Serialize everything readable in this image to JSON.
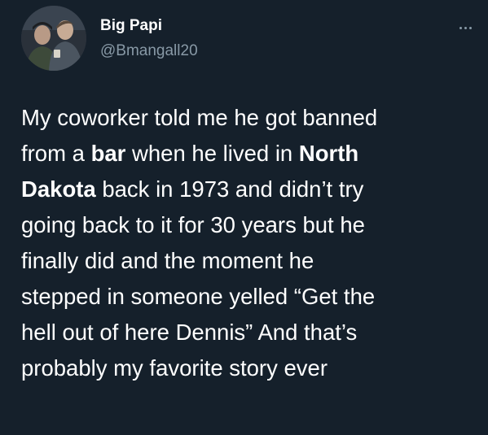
{
  "author": {
    "display_name": "Big Papi",
    "handle": "@Bmangall20",
    "avatar_icon": "profile-photo-two-men"
  },
  "menu": {
    "icon": "more-options-icon"
  },
  "tweet": {
    "lines": [
      [
        {
          "text": "My coworker told me he got banned",
          "bold": false
        }
      ],
      [
        {
          "text": "from a ",
          "bold": false
        },
        {
          "text": "bar",
          "bold": true
        },
        {
          "text": " when he lived in ",
          "bold": false
        },
        {
          "text": "North",
          "bold": true
        }
      ],
      [
        {
          "text": "Dakota",
          "bold": true
        },
        {
          "text": " back in 1973 and didn’t try",
          "bold": false
        }
      ],
      [
        {
          "text": "going back to it for 30 years but he",
          "bold": false
        }
      ],
      [
        {
          "text": "finally did and the moment he",
          "bold": false
        }
      ],
      [
        {
          "text": "stepped in someone yelled “Get the",
          "bold": false
        }
      ],
      [
        {
          "text": "hell out of here Dennis” And that’s",
          "bold": false
        }
      ],
      [
        {
          "text": "probably my favorite story ever",
          "bold": false
        }
      ]
    ]
  },
  "colors": {
    "background": "#15202b",
    "primary_text": "#ffffff",
    "secondary_text": "#8899a6"
  }
}
